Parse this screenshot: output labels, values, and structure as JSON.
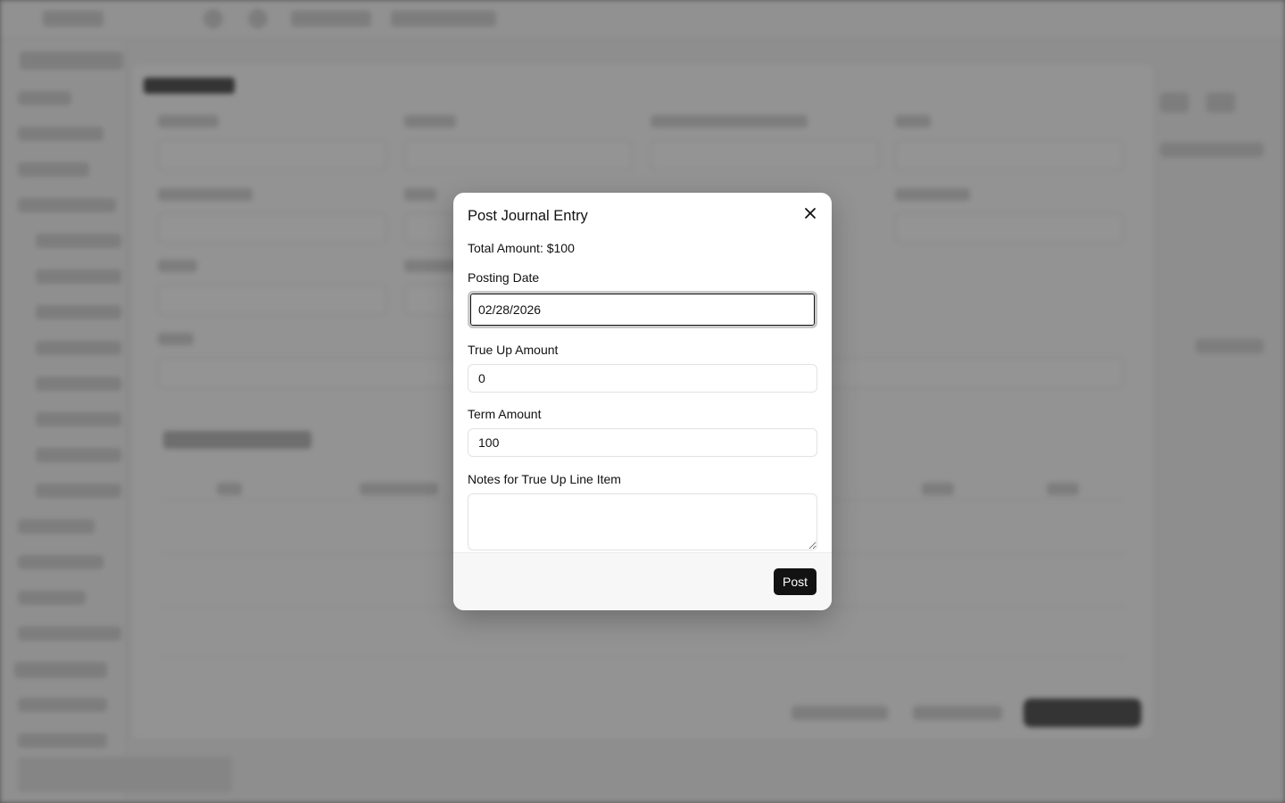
{
  "modal": {
    "title": "Post Journal Entry",
    "total_amount": "Total Amount: $100",
    "posting_date": {
      "label": "Posting Date",
      "value": "02/28/2026"
    },
    "true_up_amount": {
      "label": "True Up Amount",
      "value": "0"
    },
    "term_amount": {
      "label": "Term Amount",
      "value": "100"
    },
    "notes": {
      "label": "Notes for True Up Line Item",
      "value": ""
    },
    "post_label": "Post"
  },
  "colors": {
    "primary_button": "#121212",
    "overlay": "rgba(0,0,0,0.42)"
  },
  "icons": {
    "close": "close-icon"
  }
}
